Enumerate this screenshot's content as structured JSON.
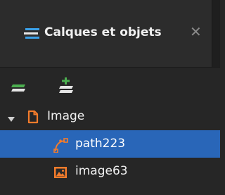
{
  "panel": {
    "tab_title": "Calques et objets",
    "tab_icon": "layers-icon",
    "close_glyph": "✕"
  },
  "toolbar": {
    "buttons": [
      {
        "icon": "new-layer-icon"
      },
      {
        "icon": "add-sublayer-icon"
      }
    ]
  },
  "tree": {
    "items": [
      {
        "label": "Image",
        "icon": "document-icon",
        "expanded": true,
        "selected": false
      },
      {
        "label": "path223",
        "icon": "path-icon",
        "selected": true
      },
      {
        "label": "image63",
        "icon": "image-icon",
        "selected": false
      }
    ]
  },
  "colors": {
    "accent_orange": "#f57c2b",
    "selection": "#2966b8",
    "layer_blue": "#3aa0e8",
    "layer_green": "#4caf50"
  }
}
